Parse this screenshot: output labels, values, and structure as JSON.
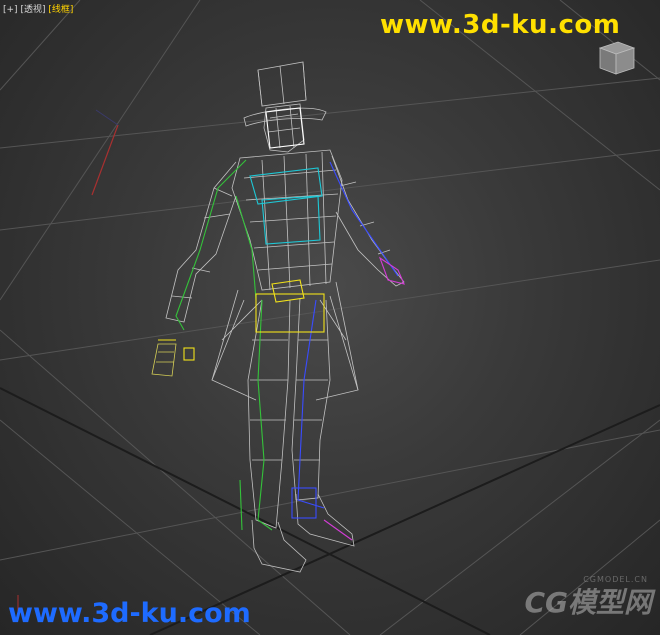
{
  "viewport": {
    "labels": [
      "[+]",
      "[透视]",
      "[线框]"
    ],
    "active_label_index": 2
  },
  "watermarks": {
    "top": "www.3d-ku.com",
    "bottom": "www.3d-ku.com",
    "logo_text": "CG模型网",
    "logo_small": "CGMODEL.CN"
  },
  "viewcube": {
    "icon": "viewcube-icon"
  },
  "colors": {
    "active_label": "#ffd200",
    "watermark_top": "#ffe000",
    "watermark_bottom": "#1e6bff",
    "wireframe": "#d0d0d0",
    "bone_green": "#34c23a",
    "bone_blue": "#3a4cff",
    "bone_yellow": "#f2e21a",
    "bone_magenta": "#d33cd6",
    "bone_cyan": "#1ec8d6"
  }
}
